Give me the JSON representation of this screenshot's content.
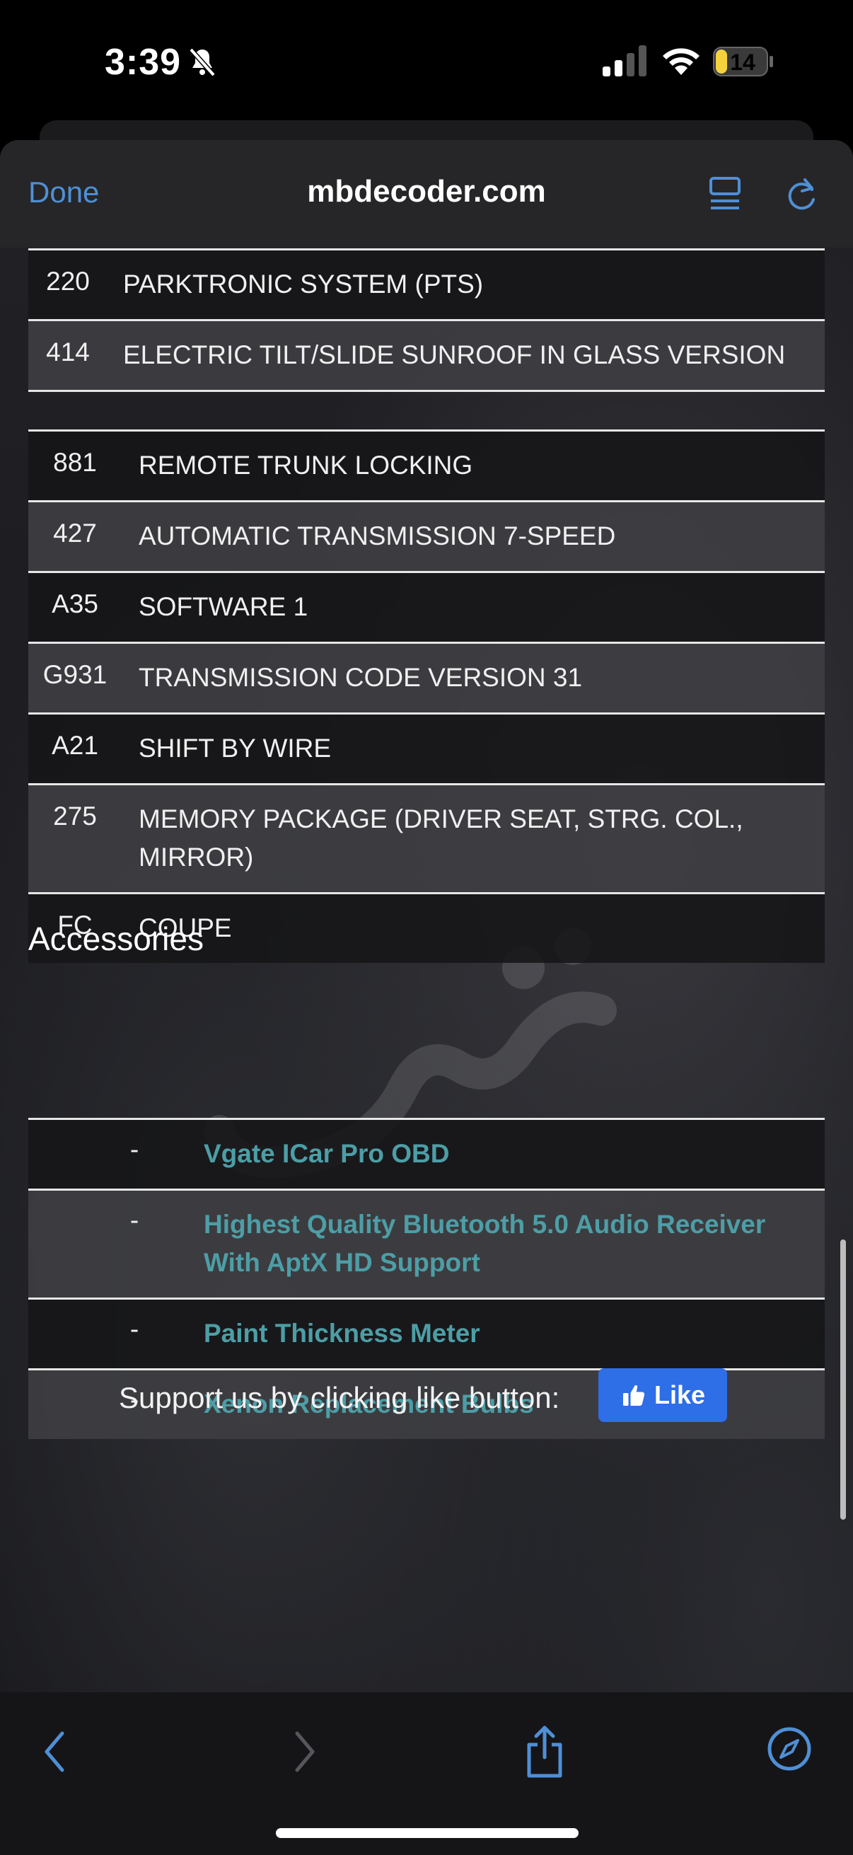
{
  "status_bar": {
    "time": "3:39",
    "battery": "14"
  },
  "browser": {
    "done_label": "Done",
    "site": "mbdecoder.com"
  },
  "options_top": [
    {
      "code": "220",
      "desc": "PARKTRONIC SYSTEM (PTS)"
    },
    {
      "code": "414",
      "desc": "ELECTRIC TILT/SLIDE SUNROOF IN GLASS VERSION"
    }
  ],
  "options_bottom": [
    {
      "code": "881",
      "desc": "REMOTE TRUNK LOCKING"
    },
    {
      "code": "427",
      "desc": "AUTOMATIC TRANSMISSION 7-SPEED"
    },
    {
      "code": "A35",
      "desc": "SOFTWARE 1"
    },
    {
      "code": "G931",
      "desc": "TRANSMISSION CODE VERSION 31"
    },
    {
      "code": "A21",
      "desc": "SHIFT BY WIRE"
    },
    {
      "code": "275",
      "desc": "MEMORY PACKAGE (DRIVER SEAT, STRG. COL., MIRROR)"
    },
    {
      "code": "FC",
      "desc": "COUPE"
    }
  ],
  "accessories": {
    "title": "Accessories",
    "items": [
      {
        "dash": "-",
        "label": "Vgate ICar Pro OBD"
      },
      {
        "dash": "-",
        "label": "Highest Quality Bluetooth 5.0 Audio Receiver With AptX HD Support"
      },
      {
        "dash": "-",
        "label": "Paint Thickness Meter"
      },
      {
        "dash": "-",
        "label": "Xenon Replacement Bulbs"
      }
    ]
  },
  "support": {
    "text": "Support us by clicking like button:",
    "like_label": "Like"
  },
  "icons": [
    "bell-slash-icon",
    "cellular-signal-icon",
    "wifi-icon",
    "battery-icon",
    "reader-mode-icon",
    "reload-icon",
    "back-arrow-icon",
    "forward-arrow-icon",
    "share-icon",
    "compass-icon",
    "thumbs-up-icon"
  ],
  "colors": {
    "accent": "#4f8fd6",
    "link": "#4d9ea6",
    "like": "#2e6ee6"
  }
}
